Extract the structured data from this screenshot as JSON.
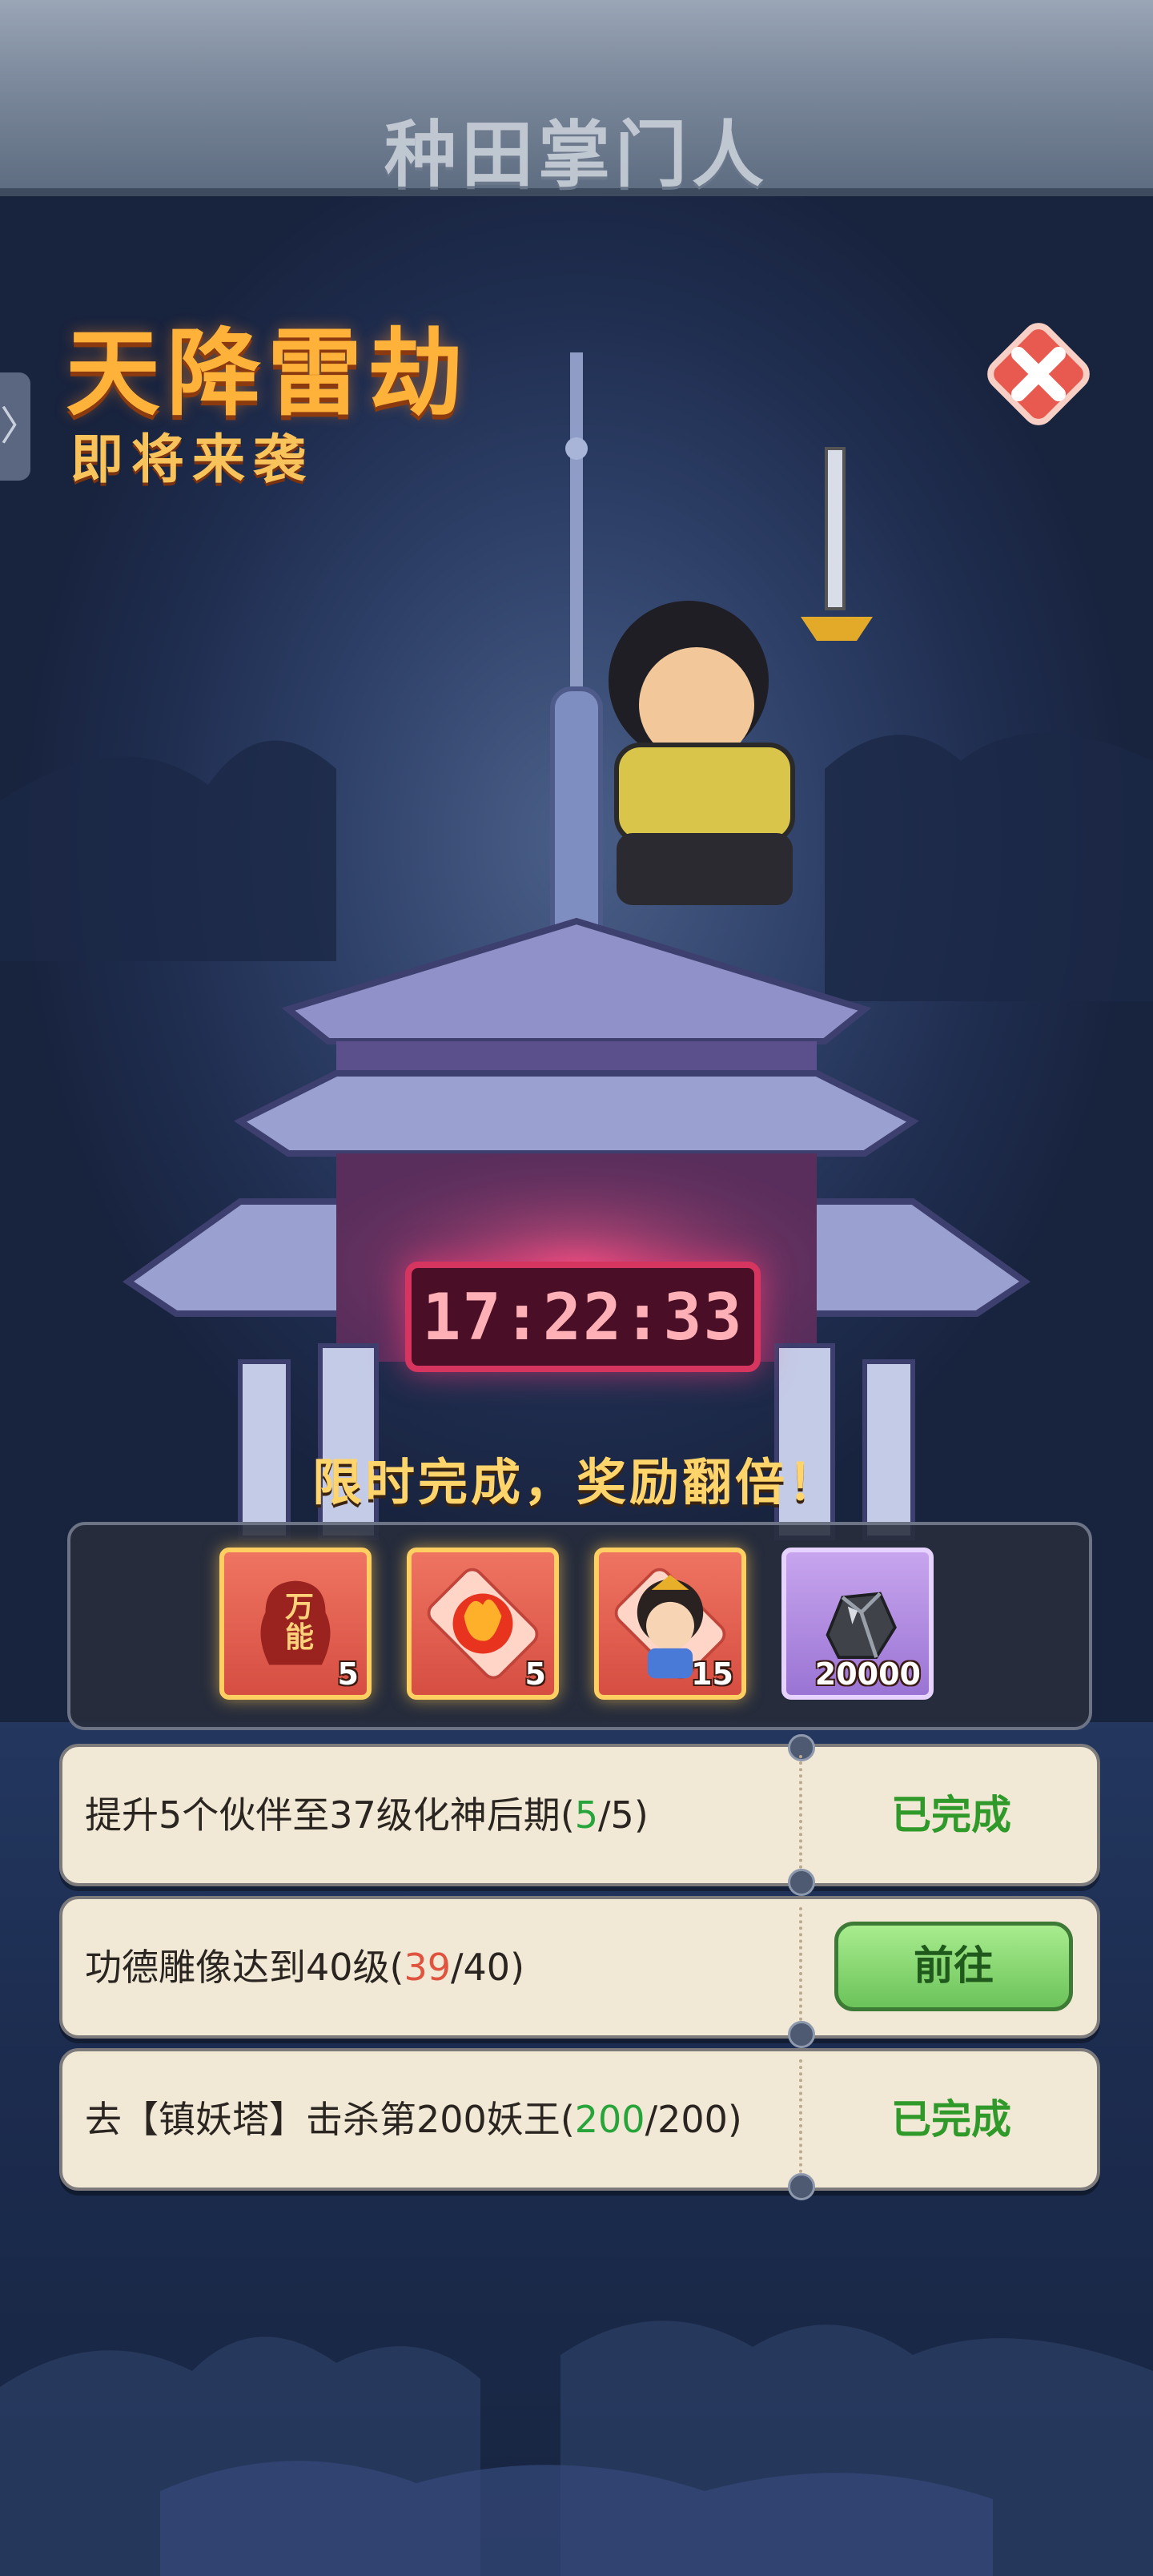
{
  "header": {
    "logo_text": "种田掌门人"
  },
  "title": {
    "main": "天降雷劫",
    "sub": "即将来袭"
  },
  "side_tab": {
    "glyph": "〉"
  },
  "timer": {
    "value": "17:22:33"
  },
  "hint": "限时完成，奖励翻倍！",
  "rewards": [
    {
      "icon": "universal-fragment-icon",
      "label": "万能",
      "count": "5",
      "frame": "red"
    },
    {
      "icon": "fire-orb-icon",
      "count": "5",
      "frame": "red"
    },
    {
      "icon": "character-portrait-icon",
      "count": "15",
      "frame": "red"
    },
    {
      "icon": "ore-icon",
      "count": "20000",
      "frame": "purple"
    }
  ],
  "tasks": [
    {
      "text": "提升5个伙伴至37级化神后期",
      "current": "5",
      "target": "/5",
      "status": "已完成",
      "state": "done"
    },
    {
      "text": "功德雕像达到40级",
      "current": "39",
      "target": "/40",
      "status": "前往",
      "state": "go"
    },
    {
      "text": "去【镇妖塔】击杀第200妖王",
      "current": "200",
      "target": "/200",
      "status": "已完成",
      "state": "done"
    }
  ],
  "colors": {
    "title_orange": "#ffb23a",
    "done_green": "#2f9a2a",
    "progress_red": "#e0533f",
    "timer_frame": "#d6355f"
  }
}
